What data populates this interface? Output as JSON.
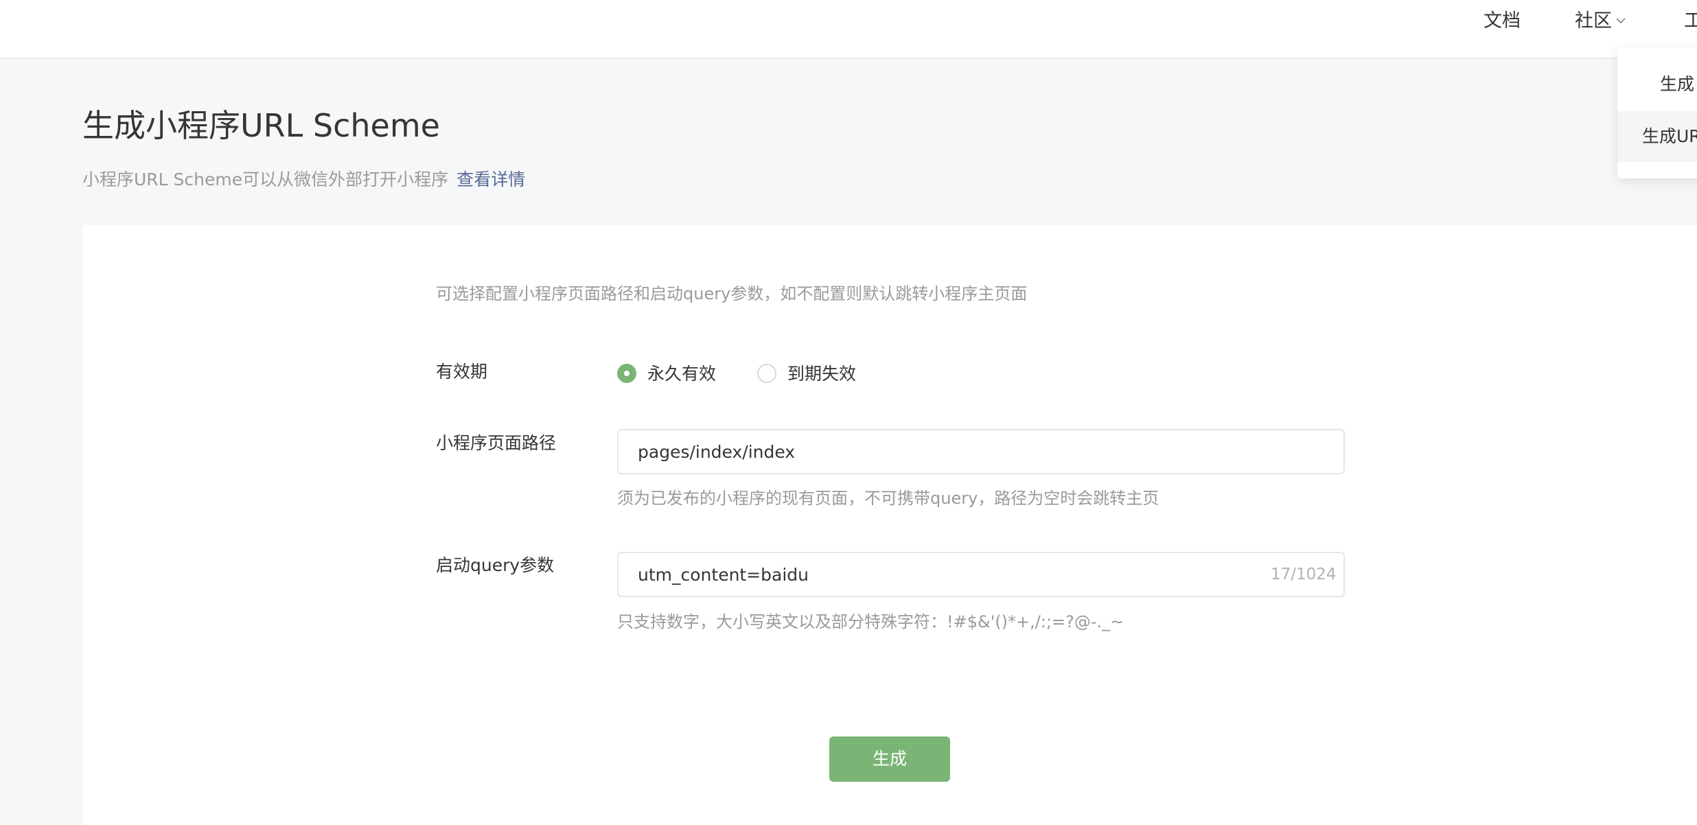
{
  "nav": {
    "docs": "文档",
    "community": "社区",
    "tools": "工"
  },
  "dropdown": {
    "item1": "生成",
    "item2": "生成UR"
  },
  "page": {
    "title": "生成小程序URL Scheme",
    "description": "小程序URL Scheme可以从微信外部打开小程序",
    "detail_link": "查看详情"
  },
  "form": {
    "hint": "可选择配置小程序页面路径和启动query参数，如不配置则默认跳转小程序主页面",
    "validity": {
      "label": "有效期",
      "options": [
        {
          "label": "永久有效",
          "checked": true
        },
        {
          "label": "到期失效",
          "checked": false
        }
      ]
    },
    "path": {
      "label": "小程序页面路径",
      "value": "pages/index/index",
      "tip": "须为已发布的小程序的现有页面，不可携带query，路径为空时会跳转主页"
    },
    "query": {
      "label": "启动query参数",
      "value": "utm_content=baidu",
      "char_count": "17/1024",
      "tip": "只支持数字，大小写英文以及部分特殊字符：!#$&'()*+,/:;=?@-._~"
    },
    "submit_label": "生成"
  },
  "colors": {
    "accent": "#7ab575",
    "link": "#576b95"
  }
}
